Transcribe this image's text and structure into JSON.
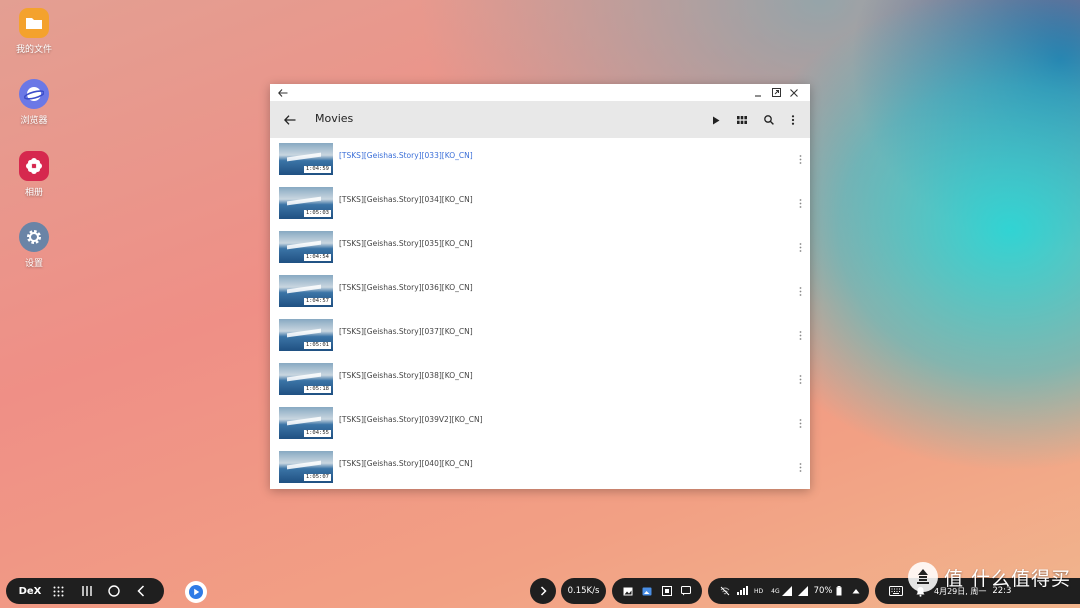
{
  "desktop": {
    "icons": [
      {
        "label": "我的文件",
        "icon": "folder-icon",
        "color": "#f4a22d"
      },
      {
        "label": "浏览器",
        "icon": "browser-icon",
        "color": "#6b78e6"
      },
      {
        "label": "相册",
        "icon": "gallery-icon",
        "color": "#d6284e"
      },
      {
        "label": "设置",
        "icon": "gear-icon",
        "color": "#6a84a6"
      }
    ]
  },
  "window": {
    "title": "Movies",
    "files": [
      {
        "name": "[TSKS][Geishas.Story][033][KO_CN]",
        "duration": "1:04:59",
        "selected": true
      },
      {
        "name": "[TSKS][Geishas.Story][034][KO_CN]",
        "duration": "1:05:03"
      },
      {
        "name": "[TSKS][Geishas.Story][035][KO_CN]",
        "duration": "1:04:54"
      },
      {
        "name": "[TSKS][Geishas.Story][036][KO_CN]",
        "duration": "1:04:57"
      },
      {
        "name": "[TSKS][Geishas.Story][037][KO_CN]",
        "duration": "1:05:01"
      },
      {
        "name": "[TSKS][Geishas.Story][038][KO_CN]",
        "duration": "1:05:18"
      },
      {
        "name": "[TSKS][Geishas.Story][039V2][KO_CN]",
        "duration": "1:04:55"
      },
      {
        "name": "[TSKS][Geishas.Story][040][KO_CN]",
        "duration": "1:05:07"
      }
    ]
  },
  "taskbar": {
    "dex_label": "DeX",
    "net_speed": "0.15K/s",
    "hd_label": "HD",
    "signal_label": "4G",
    "battery": "70%",
    "date": "4月29日, 周一",
    "time": "22:3",
    "watermark": "值 什么值得买"
  },
  "colors": {
    "selected_text": "#3b6fd8",
    "appbar_bg": "#e8e8e8",
    "taskbar_bg": "#1f1f1f"
  }
}
